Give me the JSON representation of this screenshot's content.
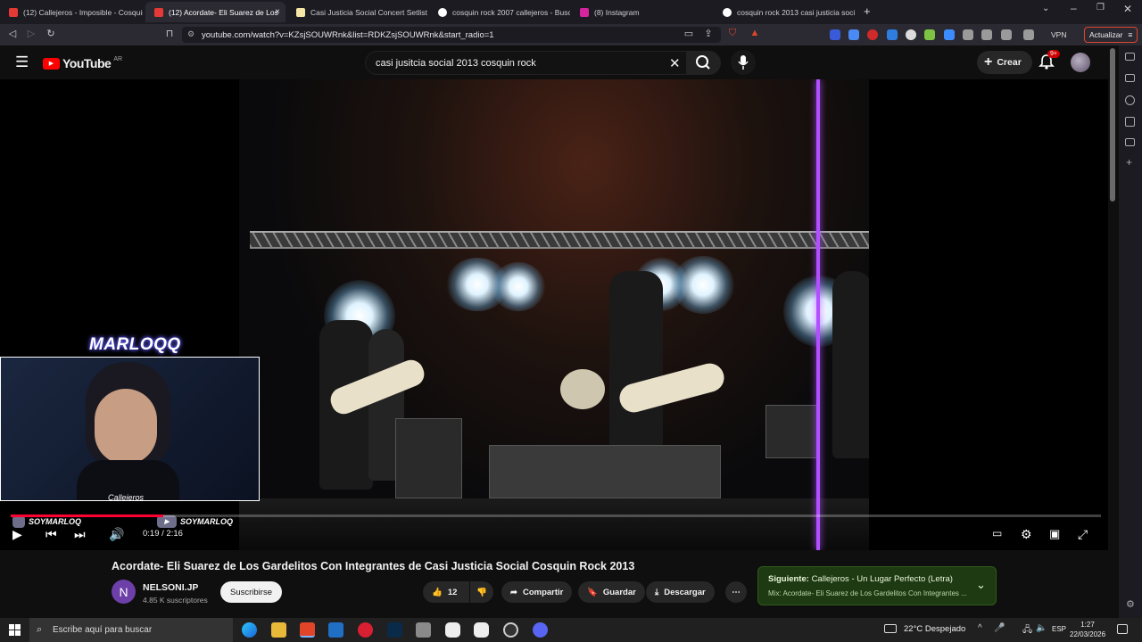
{
  "browser": {
    "tabs": [
      {
        "label": "(12) Callejeros - Imposible - Cosquin",
        "fav": "#e53935",
        "active": false
      },
      {
        "label": "(12) Acordate- Eli Suarez de Los",
        "fav": "#e53935",
        "active": true,
        "close": "×"
      },
      {
        "label": "Casi Justicia Social Concert Setlist at",
        "fav": "#f5e6a8",
        "active": false
      },
      {
        "label": "cosquin rock 2007 callejeros - Busca",
        "fav": "#ffffff",
        "active": false
      },
      {
        "label": "(8) Instagram",
        "fav": "#d6249f",
        "active": false
      },
      {
        "label": "cosquin rock 2013 casi justicia social",
        "fav": "#ffffff",
        "active": false
      }
    ],
    "new_tab": "+",
    "url": "youtube.com/watch?v=KZsjSOUWRnk&list=RDKZsjSOUWRnk&start_radio=1",
    "vpn_label": "VPN",
    "update_label": "Actualizar"
  },
  "youtube": {
    "logo_text": "YouTube",
    "region": "AR",
    "search_value": "casi jusitcia social 2013 cosquin rock",
    "create_label": "Crear",
    "notif_badge": "9+"
  },
  "player": {
    "overlay_name": "MARLOQQ",
    "social_1": "SOYMARLOQ",
    "social_2": "SOYMARLOQ",
    "webcam_caption": "Callejeros",
    "time": "0:19 / 2:16",
    "progress_fraction": 0.14
  },
  "video": {
    "title": "Acordate- Eli Suarez de Los Gardelitos Con Integrantes de Casi Justicia Social Cosquin Rock 2013",
    "channel_initial": "N",
    "channel_name": "NELSONI.JP",
    "subscribers": "4.85 K suscriptores",
    "subscribe_label": "Suscribirse",
    "likes": "12",
    "share_label": "Compartir",
    "save_label": "Guardar",
    "download_label": "Descargar"
  },
  "next": {
    "prefix": "Siguiente:",
    "title": "Callejeros - Un Lugar Perfecto (Letra)",
    "subtitle": "Mix: Acordate- Eli Suarez de Los Gardelitos Con Integrantes ..."
  },
  "taskbar": {
    "search_placeholder": "Escribe aquí para buscar",
    "weather": "22°C  Despejado",
    "lang": "ESP",
    "time": "1:27",
    "date": "22/03/2026"
  }
}
